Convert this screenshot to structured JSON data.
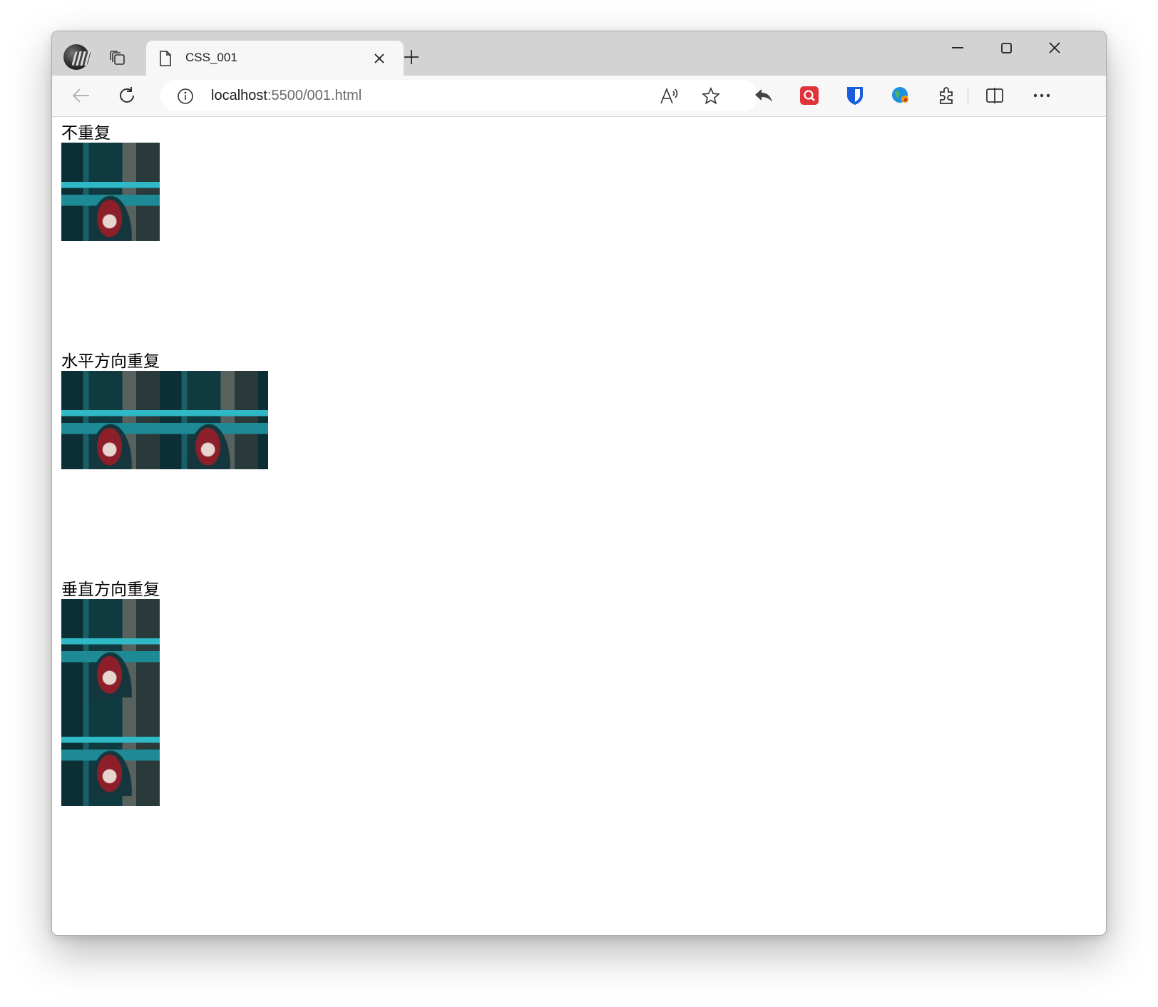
{
  "browser": {
    "tab": {
      "title": "CSS_001",
      "close_icon": "close-icon",
      "page_icon": "document-icon"
    },
    "new_tab_icon": "plus-icon",
    "window_controls": [
      "minimize-icon",
      "maximize-icon",
      "close-icon"
    ],
    "address_bar": {
      "url_host": "localhost",
      "url_rest": ":5500/001.html",
      "info_icon": "info-icon",
      "read_aloud_icon": "read-aloud-icon",
      "favorite_icon": "star-icon"
    },
    "toolbar_icons": [
      "back-icon",
      "refresh-icon",
      "share-back-icon",
      "search-extension-icon",
      "bitwarden-icon",
      "globe-extension-icon",
      "extensions-icon",
      "split-screen-icon",
      "more-icon"
    ]
  },
  "page": {
    "sections": [
      {
        "label": "不重复",
        "repeat": "no-repeat"
      },
      {
        "label": "水平方向重复",
        "repeat": "repeat-x"
      },
      {
        "label": "垂直方向重复",
        "repeat": "repeat-y"
      }
    ]
  }
}
